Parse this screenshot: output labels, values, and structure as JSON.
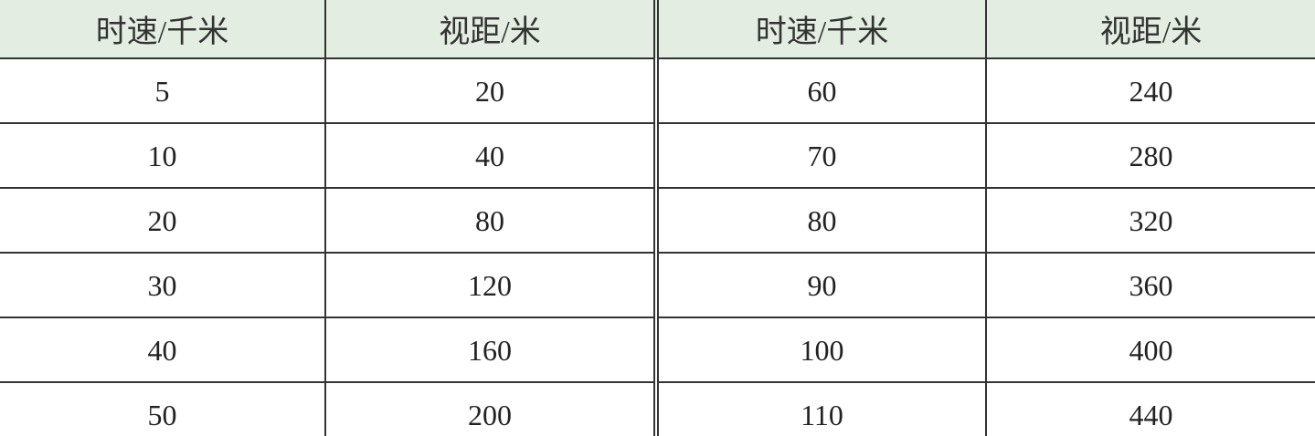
{
  "table": {
    "headers": [
      "时速/千米",
      "视距/米",
      "时速/千米",
      "视距/米"
    ],
    "rows": [
      [
        "5",
        "20",
        "60",
        "240"
      ],
      [
        "10",
        "40",
        "70",
        "280"
      ],
      [
        "20",
        "80",
        "80",
        "320"
      ],
      [
        "30",
        "120",
        "90",
        "360"
      ],
      [
        "40",
        "160",
        "100",
        "400"
      ],
      [
        "50",
        "200",
        "110",
        "440"
      ]
    ]
  },
  "colors": {
    "header_background": "#e3ede1",
    "border": "#333333"
  }
}
